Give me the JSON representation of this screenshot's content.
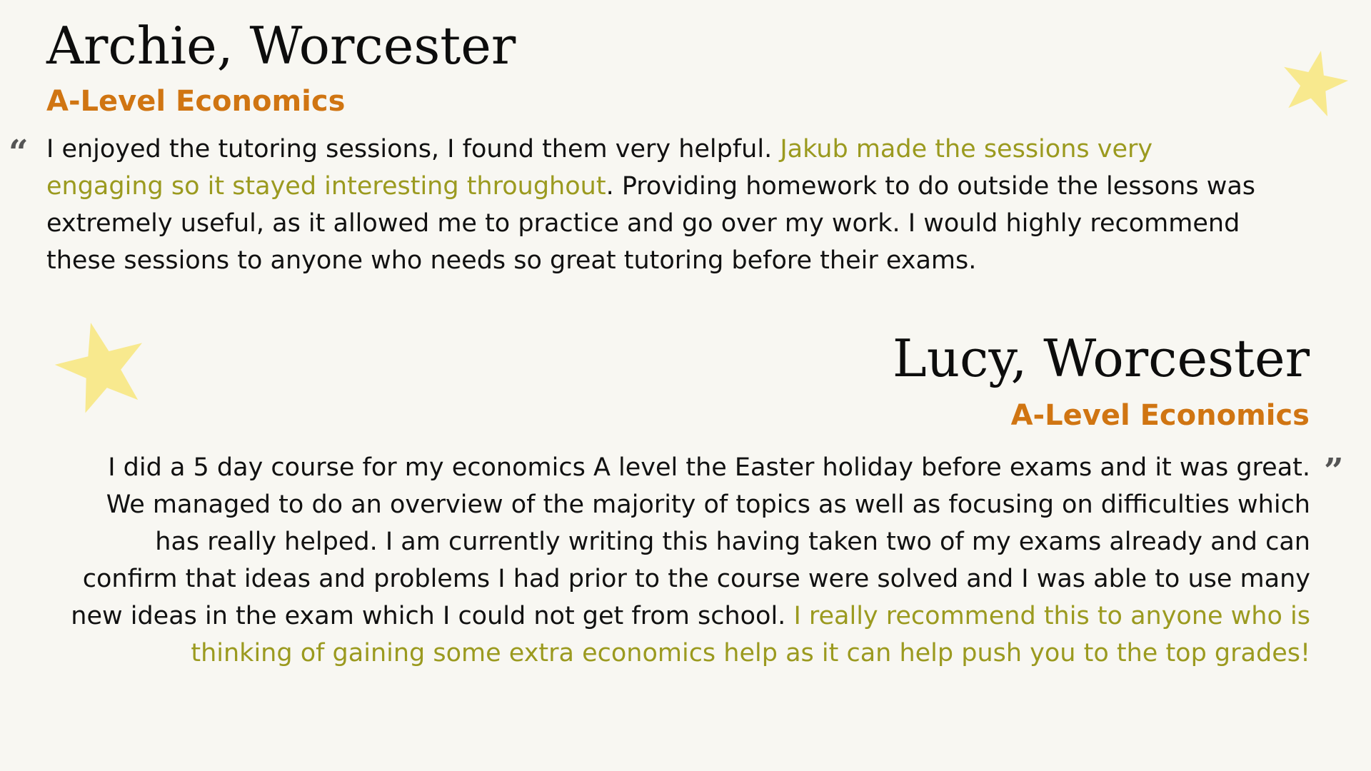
{
  "colors": {
    "background": "#f8f7f2",
    "subject": "#d07512",
    "highlight": "#9b9a1f",
    "star": "#f8e98e",
    "quote_mark": "#555555"
  },
  "testimonials": [
    {
      "name": "Archie, Worcester",
      "subject": "A-Level Economics",
      "open_quote": "“",
      "text_before": "I enjoyed the tutoring sessions, I found them very helpful. ",
      "highlight": "Jakub made the sessions very engaging so it stayed interesting throughout",
      "text_after": ". Providing homework to do outside the lessons was extremely useful, as it allowed me to practice and go over my work. I would highly recommend these sessions to anyone who needs so great tutoring before their exams."
    },
    {
      "name": "Lucy, Worcester",
      "subject": "A-Level Economics",
      "close_quote": "”",
      "text_before": "I did a 5 day course for my economics A level the Easter holiday before exams and it was great. We managed to do an overview of the majority of topics as well as focusing on difficulties which has really helped. I am currently writing this having taken two of my exams already and can confirm that ideas and problems I had prior to the course were solved and I was able to use many new ideas in the exam which I could not get from school. ",
      "highlight": "I really recommend this to anyone who is thinking of gaining some extra economics help as it can help push you to the top grades!",
      "text_after": ""
    }
  ],
  "decorations": {
    "stars": [
      "star-icon",
      "star-icon"
    ]
  }
}
